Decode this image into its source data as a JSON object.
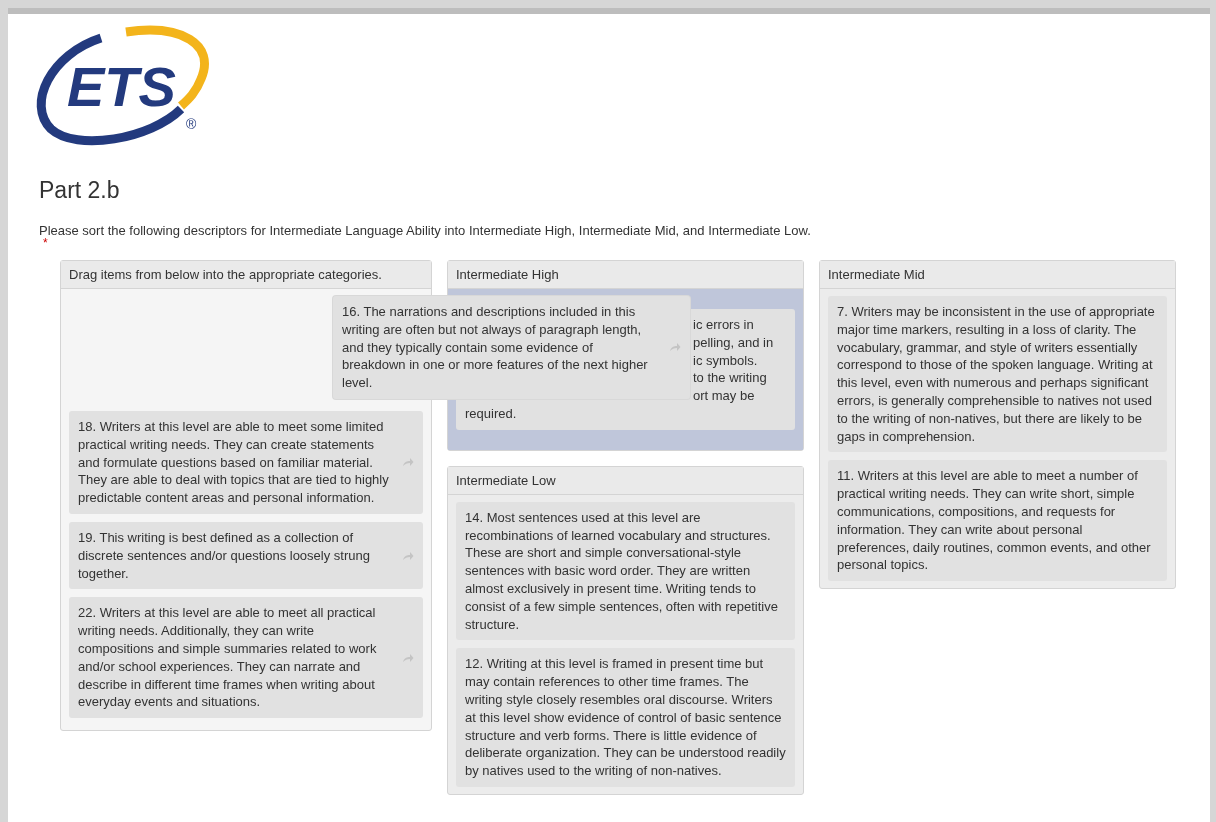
{
  "logo": {
    "text": "ETS",
    "mark": "®"
  },
  "title": "Part 2.b",
  "instructions": "Please sort the following descriptors for Intermediate Language Ability into Intermediate High, Intermediate Mid, and Intermediate Low.",
  "required_mark": "*",
  "source": {
    "heading": "Drag items from below into the appropriate categories.",
    "items": [
      {
        "text": "18. Writers at this level are able to meet some limited practical writing needs. They can create statements and formulate questions based on familiar material. They are able to deal with topics that are tied to highly predictable content areas and personal information."
      },
      {
        "text": "19. This writing is best defined as a collection of discrete sentences and/or questions loosely strung together."
      },
      {
        "text": "22. Writers at this level are able to meet all practical writing needs. Additionally, they can write compositions and simple summaries related to work and/or school experiences. They can narrate and describe in different time frames when writing about everyday events and situations."
      }
    ]
  },
  "categories": [
    {
      "heading": "Intermediate High",
      "highlighted": true,
      "items": [
        {
          "kind": "covered",
          "visible_lines": [
            "ic errors in",
            "pelling, and in",
            "ic symbols.",
            "to the writing",
            "ort may be"
          ],
          "tail": "required."
        }
      ]
    },
    {
      "heading": "Intermediate Mid",
      "highlighted": false,
      "items": [
        {
          "kind": "card",
          "text": "7. Writers may be inconsistent in the use of appropriate major time markers, resulting in a loss of clarity. The vocabulary, grammar, and style of writers essentially correspond to those of the spoken language. Writing at this level, even with numerous and perhaps significant errors, is generally comprehensible to natives not used to the writing of non-natives, but there are likely to be gaps in comprehension."
        },
        {
          "kind": "card",
          "text": "11. Writers at this level are able to meet a number of practical writing needs. They can write short, simple communications, compositions, and requests for information. They can write about personal preferences, daily routines, common events, and other personal topics."
        }
      ]
    },
    {
      "heading": "Intermediate Low",
      "highlighted": false,
      "items": [
        {
          "kind": "card",
          "text": "14. Most sentences used at this level are recombinations of learned vocabulary and structures. These are short and simple conversational-style sentences with basic word order. They are written almost exclusively in present time. Writing tends to consist of a few simple sentences, often with repetitive structure."
        },
        {
          "kind": "card",
          "text": "12. Writing at this level is framed in present time but may contain references to other time frames. The writing style closely resembles oral discourse. Writers at this level show evidence of control of basic sentence structure and verb forms. There is little evidence of deliberate organization. They can be understood readily by natives used to the writing of non-natives."
        }
      ]
    }
  ],
  "dragged_item": {
    "text": "16. The narrations and descriptions included in this writing are often but not always of paragraph length, and they typically contain some evidence of breakdown in one or more features of the next higher level."
  }
}
